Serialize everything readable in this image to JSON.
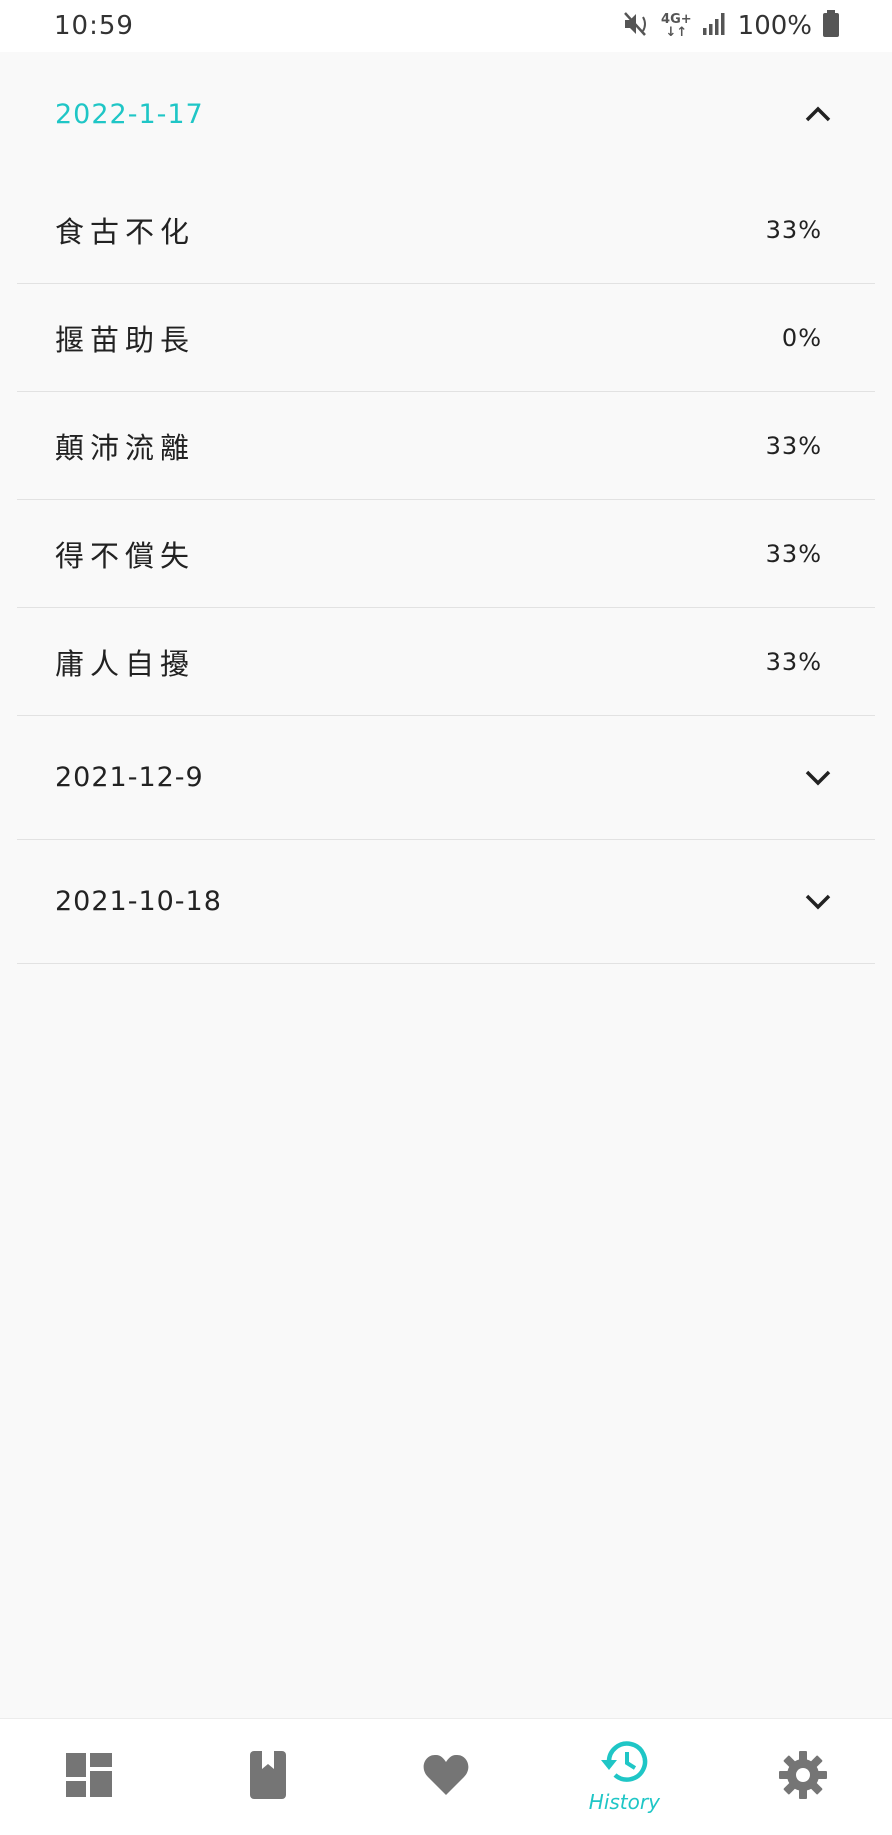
{
  "status_bar": {
    "time": "10:59",
    "network": "4G+",
    "battery": "100%"
  },
  "groups": [
    {
      "date": "2022-1-17",
      "expanded": true,
      "items": [
        {
          "name": "食古不化",
          "percent": "33%"
        },
        {
          "name": "揠苗助長",
          "percent": "0%"
        },
        {
          "name": "顛沛流離",
          "percent": "33%"
        },
        {
          "name": "得不償失",
          "percent": "33%"
        },
        {
          "name": "庸人自擾",
          "percent": "33%"
        }
      ]
    },
    {
      "date": "2021-12-9",
      "expanded": false
    },
    {
      "date": "2021-10-18",
      "expanded": false
    }
  ],
  "bottom_nav": {
    "items": [
      {
        "icon": "dashboard-icon"
      },
      {
        "icon": "bookmark-book-icon"
      },
      {
        "icon": "heart-icon"
      },
      {
        "icon": "history-icon",
        "label": "History",
        "active": true
      },
      {
        "icon": "gear-icon"
      }
    ],
    "active_color": "#1fc6c6",
    "inactive_color": "#757575"
  }
}
